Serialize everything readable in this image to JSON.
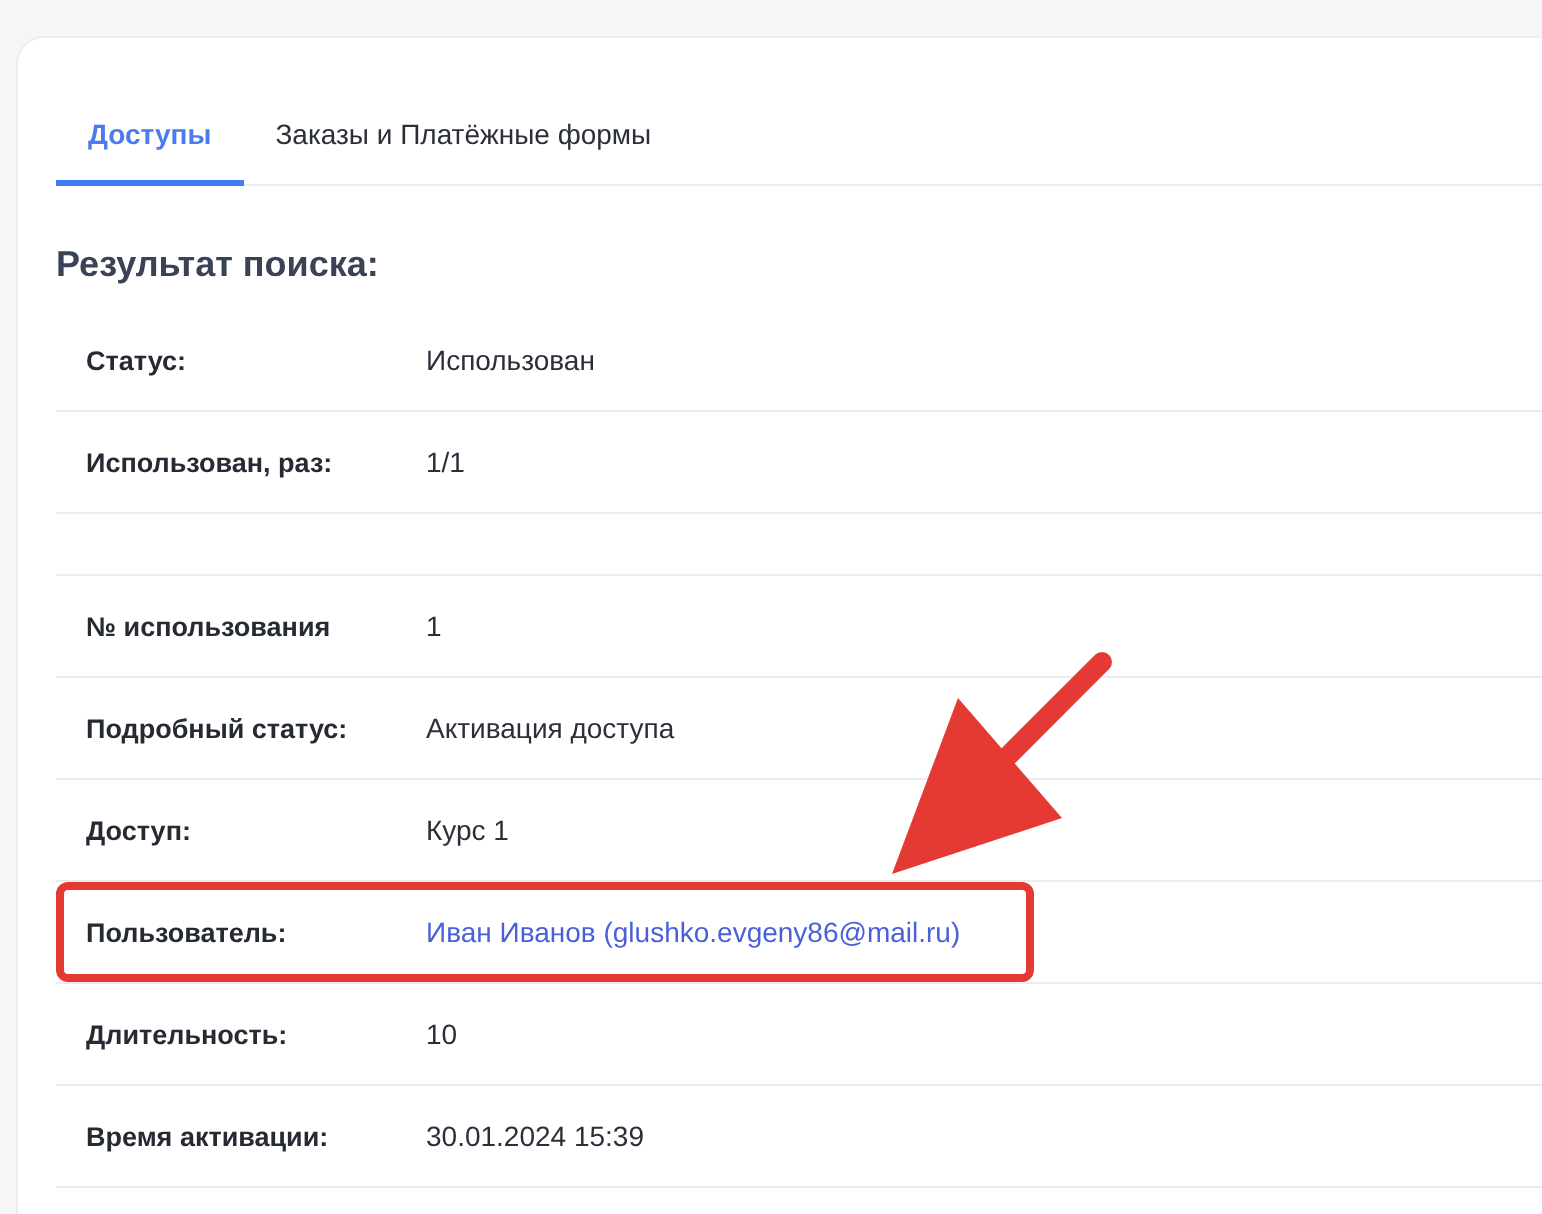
{
  "tabs": [
    {
      "label": "Доступы",
      "selected": true
    },
    {
      "label": "Заказы и Платёжные формы",
      "selected": false
    }
  ],
  "heading": "Результат поиска:",
  "rows": [
    {
      "kind": "text",
      "label": "Статус:",
      "value": "Использован",
      "highlighted": false
    },
    {
      "kind": "text",
      "label": "Использован, раз:",
      "value": "1/1",
      "highlighted": false
    },
    {
      "kind": "blank"
    },
    {
      "kind": "text",
      "label": "№ использования",
      "value": "1",
      "highlighted": false
    },
    {
      "kind": "text",
      "label": "Подробный статус:",
      "value": "Активация доступа",
      "highlighted": false
    },
    {
      "kind": "text",
      "label": "Доступ:",
      "value": "Курс 1",
      "highlighted": false
    },
    {
      "kind": "link",
      "label": "Пользователь:",
      "value": "Иван Иванов (glushko.evgeny86@mail.ru)",
      "highlighted": true
    },
    {
      "kind": "text",
      "label": "Длительность:",
      "value": "10",
      "highlighted": false
    },
    {
      "kind": "text",
      "label": "Время активации:",
      "value": "30.01.2024 15:39",
      "highlighted": false
    }
  ]
}
